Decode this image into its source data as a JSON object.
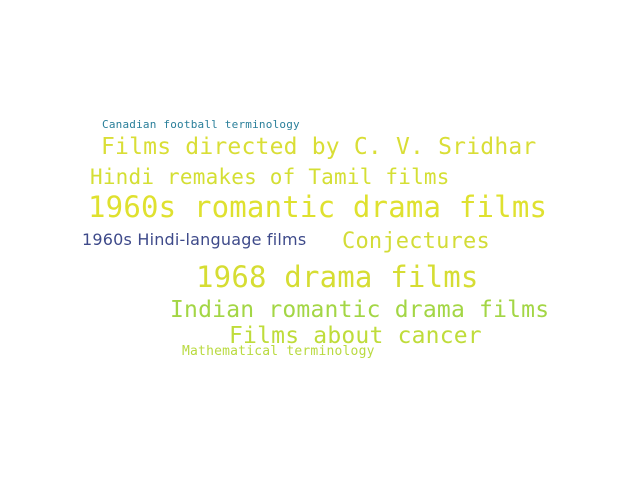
{
  "word_cloud": {
    "words": [
      {
        "text": "Canadian football terminology",
        "color": "#2a7f9a"
      },
      {
        "text": "Films directed by C. V. Sridhar",
        "color": "#d9de36"
      },
      {
        "text": "Hindi remakes of Tamil films",
        "color": "#d4df34"
      },
      {
        "text": "1960s romantic drama films",
        "color": "#dfe12f"
      },
      {
        "text": "1960s Hindi-language films",
        "color": "#3e4a8a"
      },
      {
        "text": "Conjectures",
        "color": "#d3dc37"
      },
      {
        "text": "1968 drama films",
        "color": "#d6dd33"
      },
      {
        "text": "Indian romantic drama films",
        "color": "#a3d645"
      },
      {
        "text": "Films about cancer",
        "color": "#bfdc3a"
      },
      {
        "text": "Mathematical terminology",
        "color": "#b9da40"
      }
    ]
  }
}
